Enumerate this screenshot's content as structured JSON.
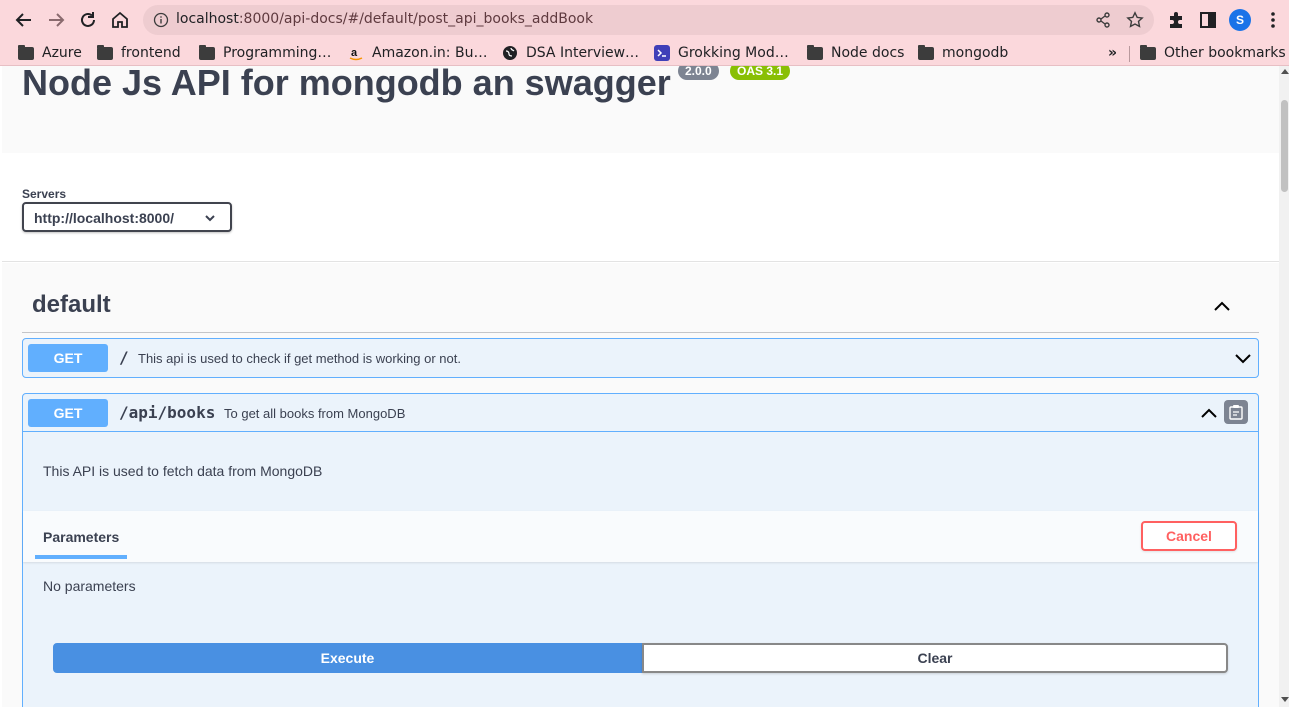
{
  "browser": {
    "url_host": "localhost",
    "url_rest": ":8000/api-docs/#/default/post_api_books_addBook",
    "profile_initial": "S",
    "bookmarks": [
      {
        "label": "Azure",
        "icon": "folder-icon"
      },
      {
        "label": "frontend",
        "icon": "folder-icon"
      },
      {
        "label": "Programming…",
        "icon": "folder-icon"
      },
      {
        "label": "Amazon.in: Bu…",
        "icon": "amazon-icon"
      },
      {
        "label": "DSA Interview…",
        "icon": "globe-icon"
      },
      {
        "label": "Grokking Mod…",
        "icon": "terminal-icon"
      },
      {
        "label": "Node docs",
        "icon": "folder-icon"
      },
      {
        "label": "mongodb",
        "icon": "folder-icon"
      }
    ],
    "bookmarks_overflow": "»",
    "other_bookmarks": "Other bookmarks"
  },
  "info": {
    "title": "Node Js API for mongodb an swagger",
    "version_badge": "2.0.0",
    "oas_badge": "OAS 3.1"
  },
  "servers": {
    "label": "Servers",
    "selected": "http://localhost:8000/"
  },
  "tag": {
    "name": "default"
  },
  "operations": [
    {
      "method": "GET",
      "path": "/",
      "summary": "This api is used to check if get method is working or not."
    },
    {
      "method": "GET",
      "path": "/api/books",
      "summary": "To get all books from MongoDB",
      "description": "This API is used to fetch data from MongoDB",
      "parameters_tab": "Parameters",
      "cancel_label": "Cancel",
      "no_params": "No parameters",
      "execute_label": "Execute",
      "clear_label": "Clear"
    }
  ],
  "colors": {
    "get_method": "#61affe",
    "execute": "#4990e2",
    "cancel": "#ff6060",
    "chrome_bg": "#fbd8dc"
  }
}
